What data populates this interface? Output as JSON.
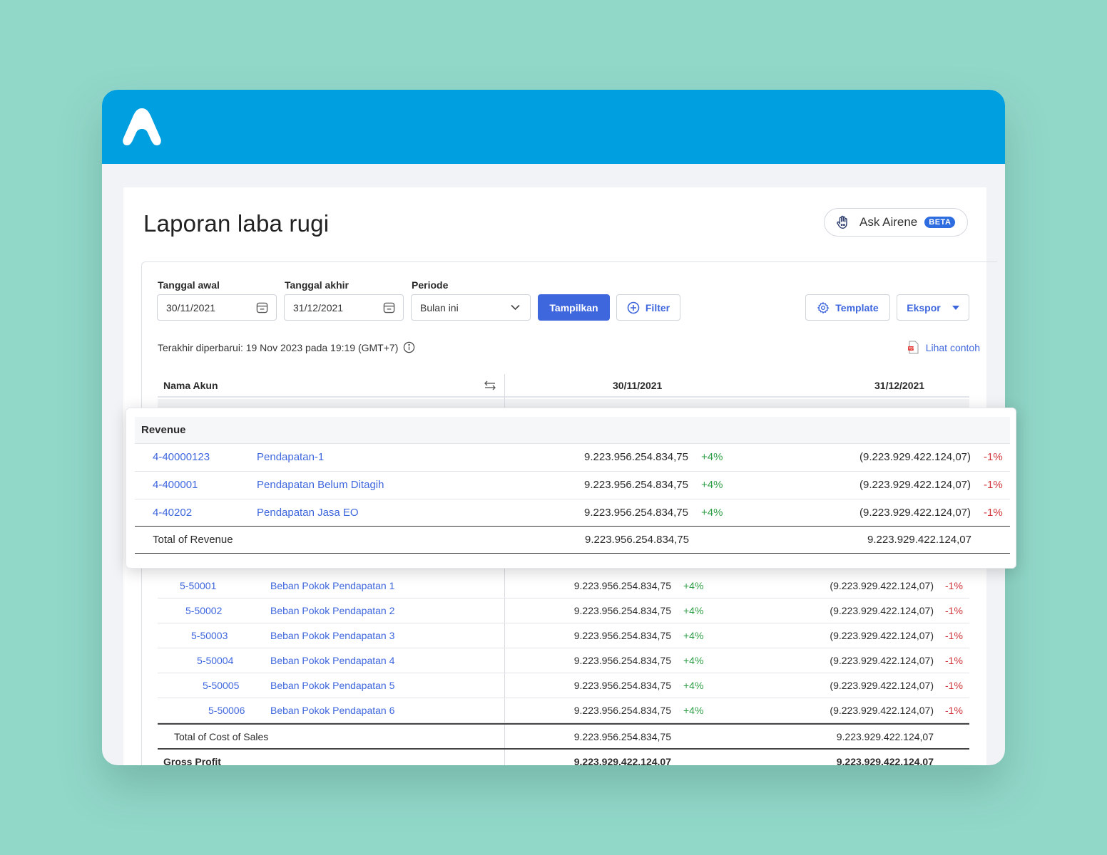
{
  "colors": {
    "background": "#92d8c9",
    "topbar": "#009fdf",
    "primary": "#3f67dd",
    "positive": "#2e9e46",
    "negative": "#d0343a"
  },
  "header": {
    "logo_icon": "app-logo-icon"
  },
  "page": {
    "title": "Laporan laba rugi"
  },
  "ask": {
    "label": "Ask Airene",
    "badge": "BETA"
  },
  "filters": {
    "start_label": "Tanggal awal",
    "start_value": "30/11/2021",
    "end_label": "Tanggal akhir",
    "end_value": "31/12/2021",
    "period_label": "Periode",
    "period_value": "Bulan ini",
    "show_button": "Tampilkan",
    "filter_button": "Filter",
    "template_button": "Template",
    "export_button": "Ekspor"
  },
  "meta": {
    "last_updated": "Terakhir diperbarui: 19 Nov 2023 pada 19:19 (GMT+7)",
    "example_link": "Lihat contoh"
  },
  "table": {
    "headers": {
      "account": "Nama Akun",
      "col1": "30/11/2021",
      "col2": "31/12/2021"
    },
    "cost_rows": [
      {
        "code": "5-50001",
        "name": "Beban Pokok Pendapatan 1",
        "v1": "9.223.956.254.834,75",
        "p1": "+4%",
        "v2": "(9.223.929.422.124,07)",
        "p2": "-1%"
      },
      {
        "code": "5-50002",
        "name": "Beban Pokok Pendapatan 2",
        "v1": "9.223.956.254.834,75",
        "p1": "+4%",
        "v2": "(9.223.929.422.124,07)",
        "p2": "-1%"
      },
      {
        "code": "5-50003",
        "name": "Beban Pokok Pendapatan 3",
        "v1": "9.223.956.254.834,75",
        "p1": "+4%",
        "v2": "(9.223.929.422.124,07)",
        "p2": "-1%"
      },
      {
        "code": "5-50004",
        "name": "Beban Pokok Pendapatan 4",
        "v1": "9.223.956.254.834,75",
        "p1": "+4%",
        "v2": "(9.223.929.422.124,07)",
        "p2": "-1%"
      },
      {
        "code": "5-50005",
        "name": "Beban Pokok Pendapatan 5",
        "v1": "9.223.956.254.834,75",
        "p1": "+4%",
        "v2": "(9.223.929.422.124,07)",
        "p2": "-1%"
      },
      {
        "code": "5-50006",
        "name": "Beban Pokok Pendapatan 6",
        "v1": "9.223.956.254.834,75",
        "p1": "+4%",
        "v2": "(9.223.929.422.124,07)",
        "p2": "-1%"
      }
    ],
    "cost_total": {
      "label": "Total of Cost of Sales",
      "v1": "9.223.956.254.834,75",
      "v2": "9.223.929.422.124,07"
    },
    "gross_profit": {
      "label": "Gross Profit",
      "v1": "9.223.929.422.124,07",
      "v2": "9.223.929.422.124,07"
    }
  },
  "revenue": {
    "section": "Revenue",
    "rows": [
      {
        "code": "4-40000123",
        "name": "Pendapatan-1",
        "v1": "9.223.956.254.834,75",
        "p1": "+4%",
        "v2": "(9.223.929.422.124,07)",
        "p2": "-1%"
      },
      {
        "code": "4-400001",
        "name": "Pendapatan Belum Ditagih",
        "v1": "9.223.956.254.834,75",
        "p1": "+4%",
        "v2": "(9.223.929.422.124,07)",
        "p2": "-1%"
      },
      {
        "code": "4-40202",
        "name": "Pendapatan Jasa EO",
        "v1": "9.223.956.254.834,75",
        "p1": "+4%",
        "v2": "(9.223.929.422.124,07)",
        "p2": "-1%"
      }
    ],
    "total": {
      "label": "Total of Revenue",
      "v1": "9.223.956.254.834,75",
      "v2": "9.223.929.422.124,07"
    }
  }
}
